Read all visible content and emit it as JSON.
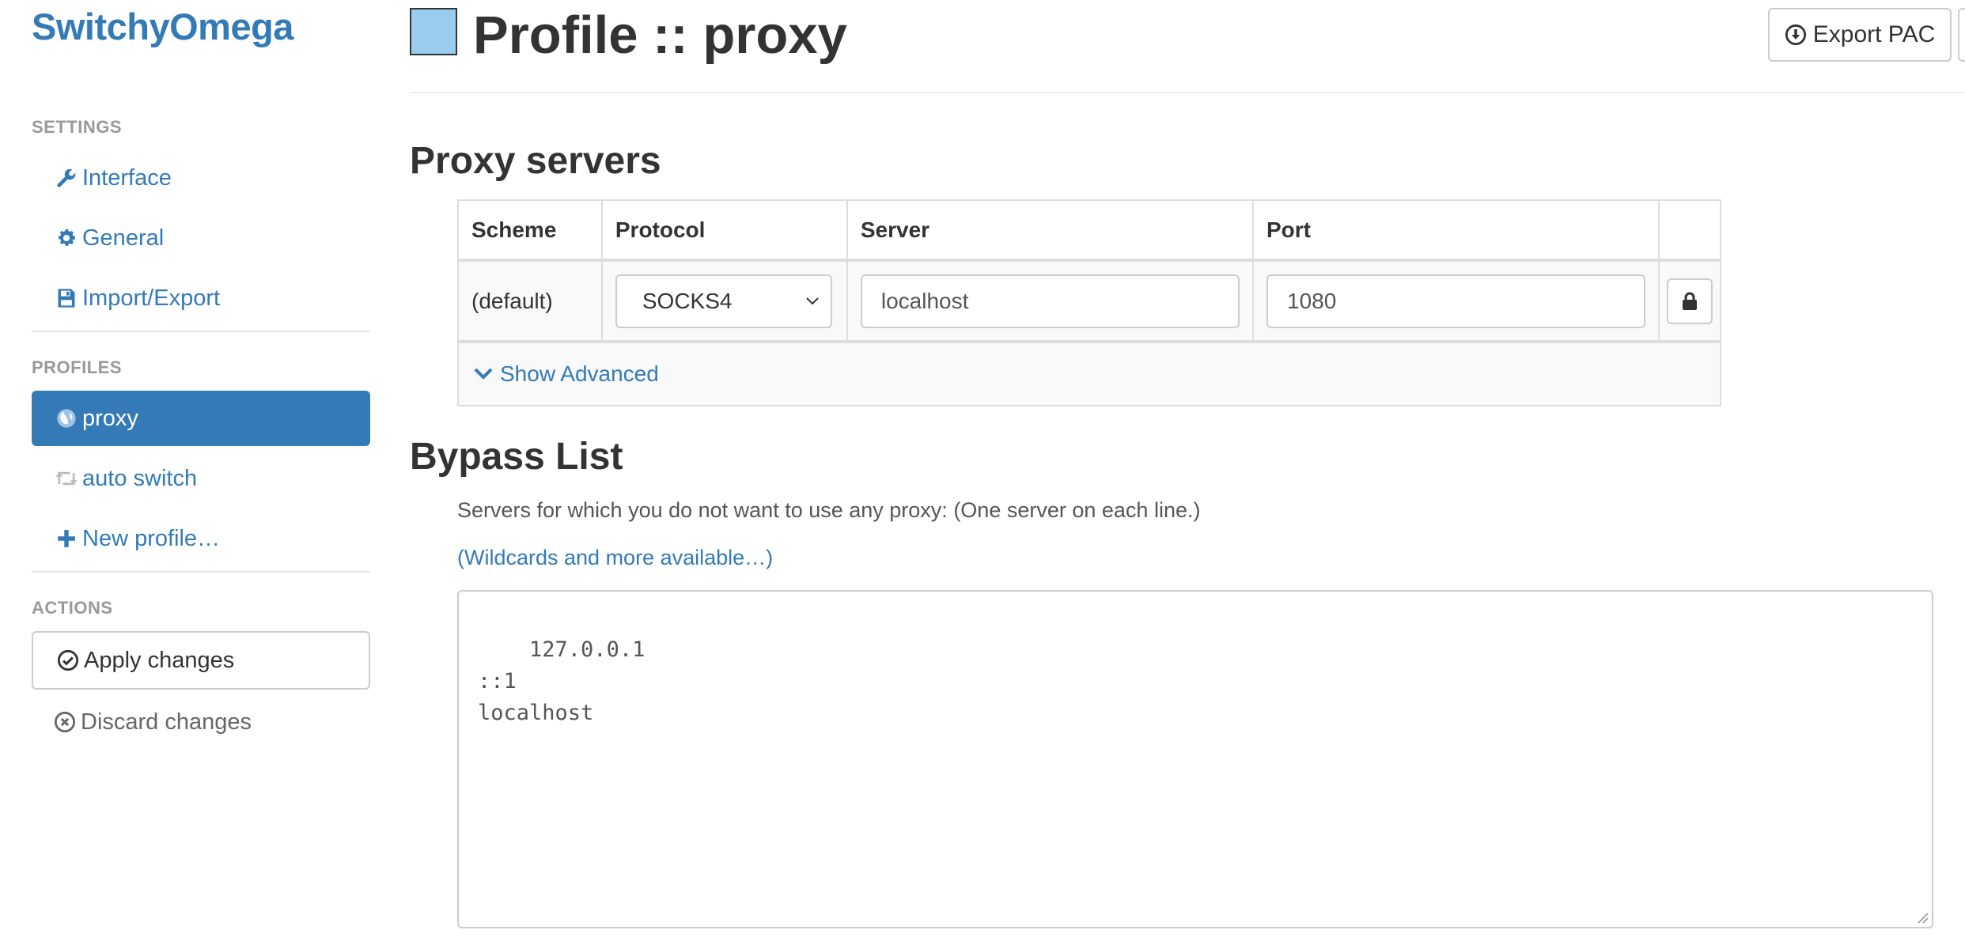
{
  "app": {
    "brand": "SwitchyOmega"
  },
  "sidebar": {
    "settings_head": "SETTINGS",
    "settings_items": [
      {
        "label": "Interface",
        "icon": "wrench-icon"
      },
      {
        "label": "General",
        "icon": "gear-icon"
      },
      {
        "label": "Import/Export",
        "icon": "floppy-icon"
      }
    ],
    "profiles_head": "PROFILES",
    "profile_items": [
      {
        "label": "proxy",
        "icon": "globe-icon",
        "active": true
      },
      {
        "label": "auto switch",
        "icon": "retweet-icon"
      },
      {
        "label": "New profile…",
        "icon": "plus-icon"
      }
    ],
    "actions_head": "ACTIONS",
    "apply_label": "Apply changes",
    "discard_label": "Discard changes"
  },
  "header": {
    "title": "Profile :: proxy",
    "swatch_color": "#99ccee",
    "export_label": "Export PAC"
  },
  "proxy_servers": {
    "heading": "Proxy servers",
    "columns": [
      "Scheme",
      "Protocol",
      "Server",
      "Port"
    ],
    "rows": [
      {
        "scheme": "(default)",
        "protocol": "SOCKS4",
        "server": "localhost",
        "port": "1080"
      }
    ],
    "show_advanced": "Show Advanced"
  },
  "bypass": {
    "heading": "Bypass List",
    "help": "Servers for which you do not want to use any proxy: (One server on each line.)",
    "help_link": "(Wildcards and more available…)",
    "value": "127.0.0.1\n::1\nlocalhost"
  },
  "colors": {
    "accent": "#337ab7",
    "muted": "#999999"
  }
}
